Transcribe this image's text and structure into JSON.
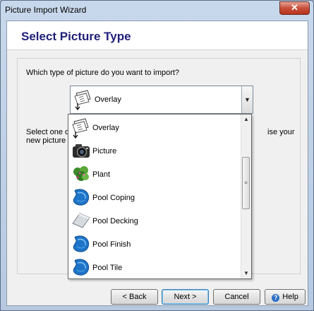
{
  "window": {
    "title": "Picture Import Wizard",
    "close_glyph": "✕"
  },
  "header": {
    "title": "Select Picture Type"
  },
  "main": {
    "question": "Which type of picture do you want to import?",
    "info_left_line1": "Select one of th",
    "info_left_line2": "new picture wit",
    "info_right_line1": "ise your"
  },
  "combo": {
    "selected": "Overlay",
    "selected_icon": "overlay-icon",
    "arrow_glyph": "▼"
  },
  "dropdown": {
    "items": [
      {
        "label": "Overlay",
        "icon": "overlay-icon"
      },
      {
        "label": "Picture",
        "icon": "camera-icon"
      },
      {
        "label": "Plant",
        "icon": "plant-icon"
      },
      {
        "label": "Pool Coping",
        "icon": "pool-coping-icon"
      },
      {
        "label": "Pool Decking",
        "icon": "pool-decking-icon"
      },
      {
        "label": "Pool Finish",
        "icon": "pool-finish-icon"
      },
      {
        "label": "Pool Tile",
        "icon": "pool-tile-icon"
      }
    ],
    "scroll_up_glyph": "▲",
    "scroll_down_glyph": "▼",
    "scroll_thumb_glyph": "≡"
  },
  "buttons": {
    "back": "< Back",
    "next": "Next >",
    "cancel": "Cancel",
    "help": "Help",
    "help_glyph": "?"
  },
  "colors": {
    "title_text": "#1f1f7a",
    "close_button": "#c7503b",
    "pool_blue": "#1e74c8"
  }
}
